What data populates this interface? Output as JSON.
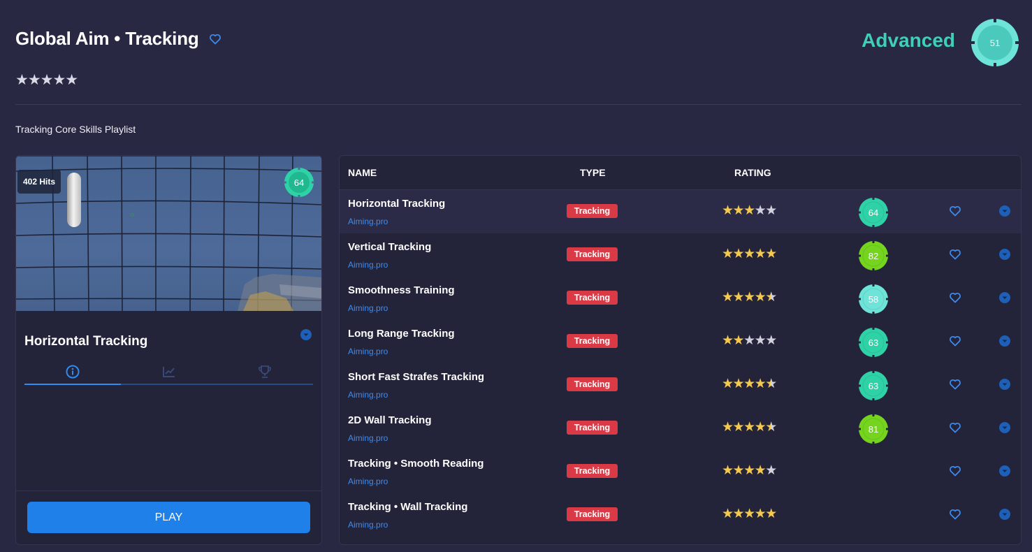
{
  "header": {
    "title": "Global Aim • Tracking",
    "stars": "★★★★★",
    "level_label": "Advanced",
    "level_value": "51",
    "level_color": "#6ee3d8",
    "playlist_label": "Tracking Core Skills Playlist"
  },
  "preview": {
    "hits": "402 Hits",
    "score": "64",
    "score_color": "#2fd2a7",
    "selected_title": "Horizontal Tracking",
    "tabs": [
      {
        "icon": "info-icon",
        "active": true
      },
      {
        "icon": "chart-icon",
        "active": false
      },
      {
        "icon": "trophy-icon",
        "active": false
      }
    ],
    "play_label": "PLAY"
  },
  "table": {
    "columns": {
      "name": "NAME",
      "type": "TYPE",
      "rating": "RATING"
    },
    "rows": [
      {
        "name": "Horizontal Tracking",
        "source": "Aiming.pro",
        "type": "Tracking",
        "rating": 3,
        "score": "64",
        "score_color": "#2fd2a7",
        "selected": true
      },
      {
        "name": "Vertical Tracking",
        "source": "Aiming.pro",
        "type": "Tracking",
        "rating": 5,
        "score": "82",
        "score_color": "#74d41e",
        "selected": false
      },
      {
        "name": "Smoothness Training",
        "source": "Aiming.pro",
        "type": "Tracking",
        "rating": 4.5,
        "score": "58",
        "score_color": "#6ee3d8",
        "selected": false
      },
      {
        "name": "Long Range Tracking",
        "source": "Aiming.pro",
        "type": "Tracking",
        "rating": 2,
        "score": "63",
        "score_color": "#2fd2a7",
        "selected": false
      },
      {
        "name": "Short Fast Strafes Tracking",
        "source": "Aiming.pro",
        "type": "Tracking",
        "rating": 4.5,
        "score": "63",
        "score_color": "#2fd2a7",
        "selected": false
      },
      {
        "name": "2D Wall Tracking",
        "source": "Aiming.pro",
        "type": "Tracking",
        "rating": 4.5,
        "score": "81",
        "score_color": "#74d41e",
        "selected": false
      },
      {
        "name": "Tracking • Smooth Reading",
        "source": "Aiming.pro",
        "type": "Tracking",
        "rating": 4,
        "score": "",
        "score_color": "",
        "selected": false
      },
      {
        "name": "Tracking • Wall Tracking",
        "source": "Aiming.pro",
        "type": "Tracking",
        "rating": 5,
        "score": "",
        "score_color": "",
        "selected": false
      }
    ]
  },
  "colors": {
    "accent_blue": "#1e80e8",
    "tag_red": "#d93a45",
    "star_gold": "#f5c94d",
    "link_blue": "#3d8cf0"
  }
}
